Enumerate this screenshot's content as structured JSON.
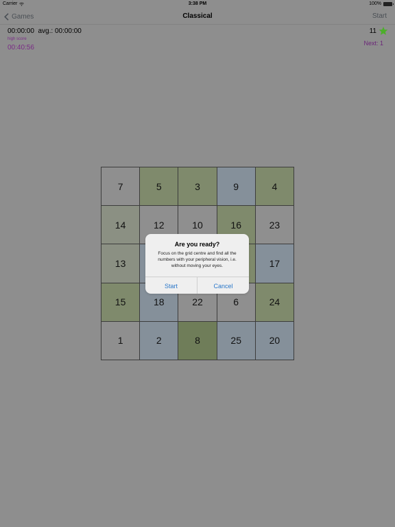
{
  "status_bar": {
    "carrier": "Carrier",
    "time": "3:38 PM",
    "battery": "100%"
  },
  "nav": {
    "back_label": "Games",
    "title": "Classical",
    "start_label": "Start"
  },
  "stats": {
    "timer_line": "00:00:00  avg.: 00:00:00",
    "high_score_label": "high score",
    "high_score_value": "00:40:56",
    "stars_count": "11",
    "next_label": "Next: 1"
  },
  "colors": {
    "gray": "#8f8f8f",
    "green": "#7f8a6c",
    "sage": "#8b9083",
    "blue": "#85909a",
    "dark_green": "#6f7d59",
    "accent_purple": "#7a2b86",
    "dialog_button": "#2a77c9",
    "star": "#4caf2a"
  },
  "grid": {
    "cells": [
      [
        "7",
        "5",
        "3",
        "9",
        "4"
      ],
      [
        "14",
        "12",
        "10",
        "16",
        "23"
      ],
      [
        "13",
        "",
        "",
        "",
        "17"
      ],
      [
        "15",
        "18",
        "22",
        "6",
        "24"
      ],
      [
        "1",
        "2",
        "8",
        "25",
        "20"
      ]
    ]
  },
  "dialog": {
    "title": "Are you ready?",
    "message": "Focus on the grid centre and find all the numbers with your peripheral vision, i.e. without moving your eyes.",
    "start_label": "Start",
    "cancel_label": "Cancel"
  },
  "icons": [
    "wifi-icon",
    "battery-icon",
    "chevron-left-icon",
    "star-icon"
  ]
}
